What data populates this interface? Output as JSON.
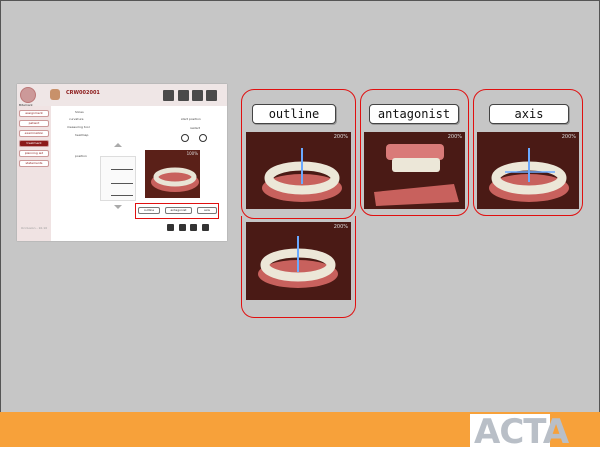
{
  "app": {
    "brand": "Bitemark",
    "title": "CRW002001",
    "sidebar_items": [
      "assignment",
      "patient",
      "examination",
      "treatment",
      "planning aid",
      "statements"
    ],
    "tool_items": [
      "Slices",
      "curvature",
      "measuring tool",
      "heatmap",
      "position"
    ],
    "right_labels": [
      "start position",
      "restart"
    ],
    "zoom": "100%",
    "footer_text": "Occlusion\n- 10.10",
    "mini_buttons": [
      "outline",
      "antagonist",
      "axis"
    ]
  },
  "panels": [
    {
      "label": "outline",
      "zoom": "200%"
    },
    {
      "label": "antagonist",
      "zoom": "200%"
    },
    {
      "label": "axis",
      "zoom": "200%"
    }
  ],
  "extra_zoom": "200%",
  "logo": "ACTA",
  "colors": {
    "footer": "#f7a13a",
    "highlight": "#e01010",
    "slide_bg": "#c6c6c6",
    "brand": "#8b1a1a"
  }
}
